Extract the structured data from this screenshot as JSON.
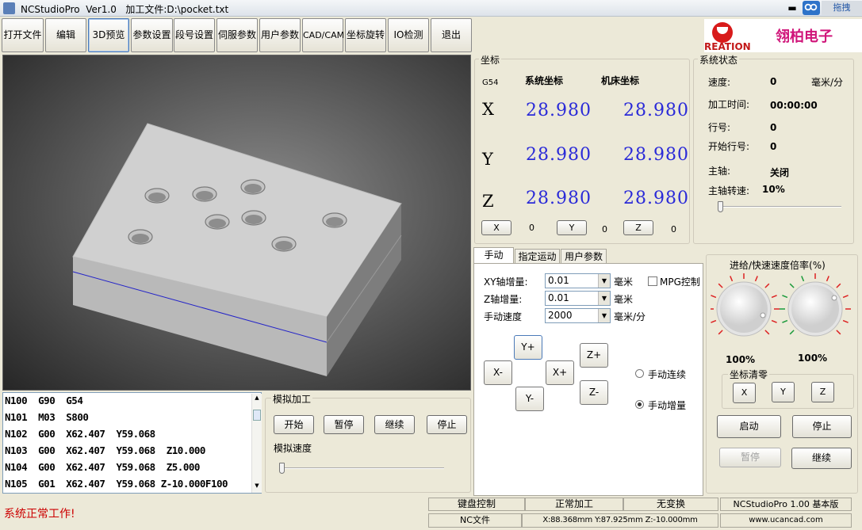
{
  "window": {
    "app_title": "NCStudioPro  Ver1.0   加工文件:D:\\pocket.txt",
    "minimize_label": "▬",
    "drag_label": "拖拽"
  },
  "toolbar": {
    "items": [
      {
        "label": "打开文件"
      },
      {
        "label": "编辑"
      },
      {
        "label": "3D预览"
      },
      {
        "label": "参数设置"
      },
      {
        "label": "段号设置"
      },
      {
        "label": "伺服参数"
      },
      {
        "label": "用户参数"
      },
      {
        "label": "CAD/CAM"
      },
      {
        "label": "坐标旋转"
      },
      {
        "label": "IO检测"
      },
      {
        "label": "退出"
      }
    ]
  },
  "logo": {
    "brand_text": "REATION",
    "company": "翎柏电子",
    "colors": {
      "brand": "#c21818",
      "company": "#d0157a"
    }
  },
  "code_list": {
    "lines": [
      "N100  G90  G54",
      "N101  M03  S800",
      "N102  G00  X62.407  Y59.068",
      "N103  G00  X62.407  Y59.068  Z10.000",
      "N104  G00  X62.407  Y59.068  Z5.000",
      "N105  G01  X62.407  Y59.068 Z-10.000F100"
    ]
  },
  "simulation": {
    "group_title": "模拟加工",
    "start": "开始",
    "pause": "暂停",
    "resume": "继续",
    "stop": "停止",
    "speed_label": "模拟速度"
  },
  "coordinates": {
    "group_title": "坐标",
    "wcs": "G54",
    "system_header": "系统坐标",
    "machine_header": "机床坐标",
    "axes": [
      {
        "name": "X",
        "system": "28.980",
        "machine": "28.980"
      },
      {
        "name": "Y",
        "system": "28.980",
        "machine": "28.980"
      },
      {
        "name": "Z",
        "system": "28.980",
        "machine": "28.980"
      }
    ],
    "zero_buttons": [
      {
        "label": "X",
        "value": "0"
      },
      {
        "label": "Y",
        "value": "0"
      },
      {
        "label": "Z",
        "value": "0"
      }
    ],
    "value_color": "#2a2ad8"
  },
  "system_status": {
    "group_title": "系统状态",
    "speed_label": "速度:",
    "speed_value": "0",
    "speed_unit": "毫米/分",
    "time_label": "加工时间:",
    "time_value": "00:00:00",
    "line_label": "行号:",
    "line_value": "0",
    "start_line_label": "开始行号:",
    "start_line_value": "0",
    "spindle_label": "主轴:",
    "spindle_value": "关闭",
    "spindle_speed_label": "主轴转速:",
    "spindle_speed_value": "10%",
    "spindle_speed_fraction": 0.0
  },
  "manual": {
    "tabs": [
      {
        "label": "手动",
        "selected": true
      },
      {
        "label": "指定运动",
        "selected": false
      },
      {
        "label": "用户参数",
        "selected": false
      }
    ],
    "xy_step_label": "XY轴增量:",
    "xy_step_value": "0.01",
    "z_step_label": "Z轴增量:",
    "z_step_value": "0.01",
    "speed_label": "手动速度",
    "speed_value": "2000",
    "unit_mm": "毫米",
    "unit_mm_min": "毫米/分",
    "mpg_label": "MPG控制",
    "mpg_checked": false,
    "jog": {
      "yplus": "Y+",
      "yminus": "Y-",
      "xminus": "X-",
      "xplus": "X+",
      "zplus": "Z+",
      "zminus": "Z-"
    },
    "mode_continuous": "手动连续",
    "mode_step": "手动增量",
    "selected_mode": "手动增量"
  },
  "override": {
    "title": "进给/快速速度倍率(%)",
    "feed_value": "100%",
    "rapid_value": "100%",
    "zero_group_title": "坐标清零",
    "zero_x": "X",
    "zero_y": "Y",
    "zero_z": "Z",
    "start": "启动",
    "stop": "停止",
    "pause": "暂停",
    "resume": "继续"
  },
  "status_bar": {
    "message": "系统正常工作!",
    "message_color": "#cc0000",
    "keyboard": "键盘控制",
    "mode": "正常加工",
    "transform": "无变换",
    "version": "NCStudioPro 1.00 基本版",
    "file": "NC文件",
    "position": "X:88.368mm Y:87.925mm Z:-10.000mm",
    "url": "www.ucancad.com"
  }
}
